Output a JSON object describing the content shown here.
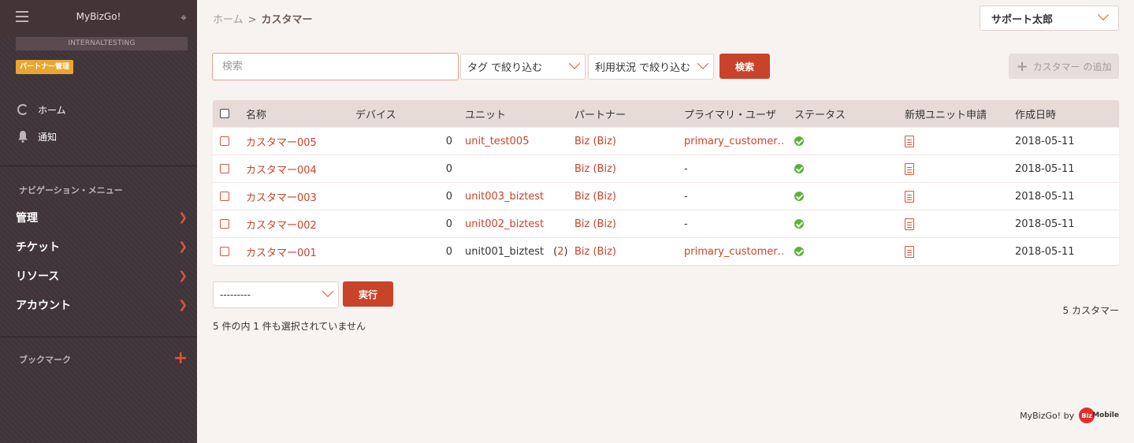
{
  "sidebar": {
    "app_name": "MyBizGo!",
    "environment": "INTERNALTESTING",
    "partner_badge": "パートナー管理",
    "home_label": "ホーム",
    "notifications_label": "通知",
    "nav_section_label": "ナビゲーション・メニュー",
    "nav_items": [
      {
        "label": "管理"
      },
      {
        "label": "チケット"
      },
      {
        "label": "リソース"
      },
      {
        "label": "アカウント"
      }
    ],
    "bookmarks_label": "ブックマーク"
  },
  "header": {
    "breadcrumb_home": "ホーム",
    "breadcrumb_current": "カスタマー",
    "user_name": "サポート太郎"
  },
  "toolbar": {
    "search_placeholder": "検索",
    "tag_filter": "タグ で絞り込む",
    "usage_filter": "利用状況 で絞り込む",
    "search_button": "検索",
    "add_customer_button": "カスタマー の追加"
  },
  "table": {
    "columns": [
      "名称",
      "デバイス",
      "ユニット",
      "パートナー",
      "プライマリ・ユーザ",
      "ステータス",
      "新規ユニット申請",
      "作成日時"
    ],
    "rows": [
      {
        "name": "カスタマー005",
        "devices": "0",
        "unit": "unit_test005",
        "unit_extra": "",
        "partner": "Biz (Biz)",
        "primary_user": "primary_customer…",
        "created": "2018-05-11"
      },
      {
        "name": "カスタマー004",
        "devices": "0",
        "unit": "",
        "unit_extra": "",
        "partner": "Biz (Biz)",
        "primary_user": "-",
        "created": "2018-05-11"
      },
      {
        "name": "カスタマー003",
        "devices": "0",
        "unit": "unit003_biztest",
        "unit_extra": "",
        "partner": "Biz (Biz)",
        "primary_user": "-",
        "created": "2018-05-11"
      },
      {
        "name": "カスタマー002",
        "devices": "0",
        "unit": "unit002_biztest",
        "unit_extra": "",
        "partner": "Biz (Biz)",
        "primary_user": "-",
        "created": "2018-05-11"
      },
      {
        "name": "カスタマー001",
        "devices": "0",
        "unit": "unit001_biztest",
        "unit_extra": "2",
        "partner": "Biz (Biz)",
        "primary_user": "primary_customer…",
        "created": "2018-05-11"
      }
    ]
  },
  "actions": {
    "select_value": "---------",
    "run_button": "実行",
    "selection_status": "5 件の内 1 件も選択されていません",
    "count_label": "5 カスタマー"
  },
  "footer": {
    "text": "MyBizGo! by",
    "logo_mark": "Biz",
    "logo_text": "Mobile"
  },
  "colors": {
    "accent": "#c9432a",
    "sidebar_bg": "#3f3439",
    "status_ok": "#5ab435",
    "badge": "#e8a733"
  }
}
